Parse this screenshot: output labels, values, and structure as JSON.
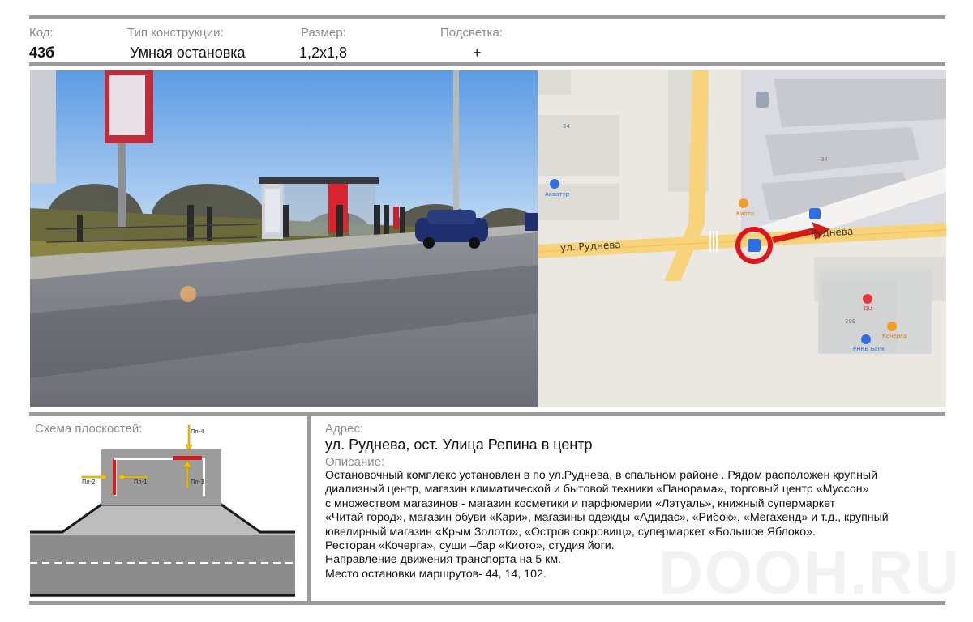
{
  "header": {
    "code_label": "Код:",
    "code_value": "43б",
    "type_label": "Тип конструкции:",
    "type_value": "Умная остановка",
    "size_label": "Размер:",
    "size_value": "1,2х1,8",
    "light_label": "Подсветка:",
    "light_value": "+"
  },
  "map": {
    "street_left": "ул. Руднева",
    "street_right": "Руднева",
    "bld_34_a": "34",
    "bld_34_b": "34",
    "bld_39v": "39В",
    "poi_akvatur": "Акватур",
    "poi_kioto": "Киото",
    "poi_dc": "ДЦ",
    "poi_kocherga": "Кочерга",
    "poi_rnkb": "РНКБ Банк"
  },
  "scheme": {
    "label": "Схема плоскостей:",
    "pl1": "Пл-1",
    "pl2": "Пл-2",
    "pl3": "Пл-3",
    "pl4": "Пл-4"
  },
  "address": {
    "label": "Адрес:",
    "value": "ул. Руднева, ост. Улица Репина в центр"
  },
  "description": {
    "label": "Описание:",
    "lines": [
      "Остановочный комплекс установлен в  по ул.Руднева, в спальном районе . Рядом расположен крупный",
      "диализный центр,  магазин климатической и бытовой техники «Панорама», торговый центр «Муссон»",
      "с множеством магазинов - магазин косметики и парфюмерии «Лэтуаль», книжный супермаркет",
      "«Читай город», магазин обуви «Кари», магазины одежды  «Адидас», «Рибок», «Мегахенд» и т.д., крупный",
      "ювелирный магазин «Крым Золото», «Остров сокровищ», супермаркет «Большое Яблоко».",
      "Ресторан «Кочерга», суши –бар «Киото»,  студия йоги.",
      "Направление движения транспорта на 5 км.",
      "Место остановки маршрутов- 44, 14, 102."
    ]
  },
  "watermark": "DOOH.RU",
  "colors": {
    "rule": "#9a9a9a",
    "marker": "#e0141e",
    "arrow": "#f2c400",
    "label_gray": "#8a8a8a"
  }
}
